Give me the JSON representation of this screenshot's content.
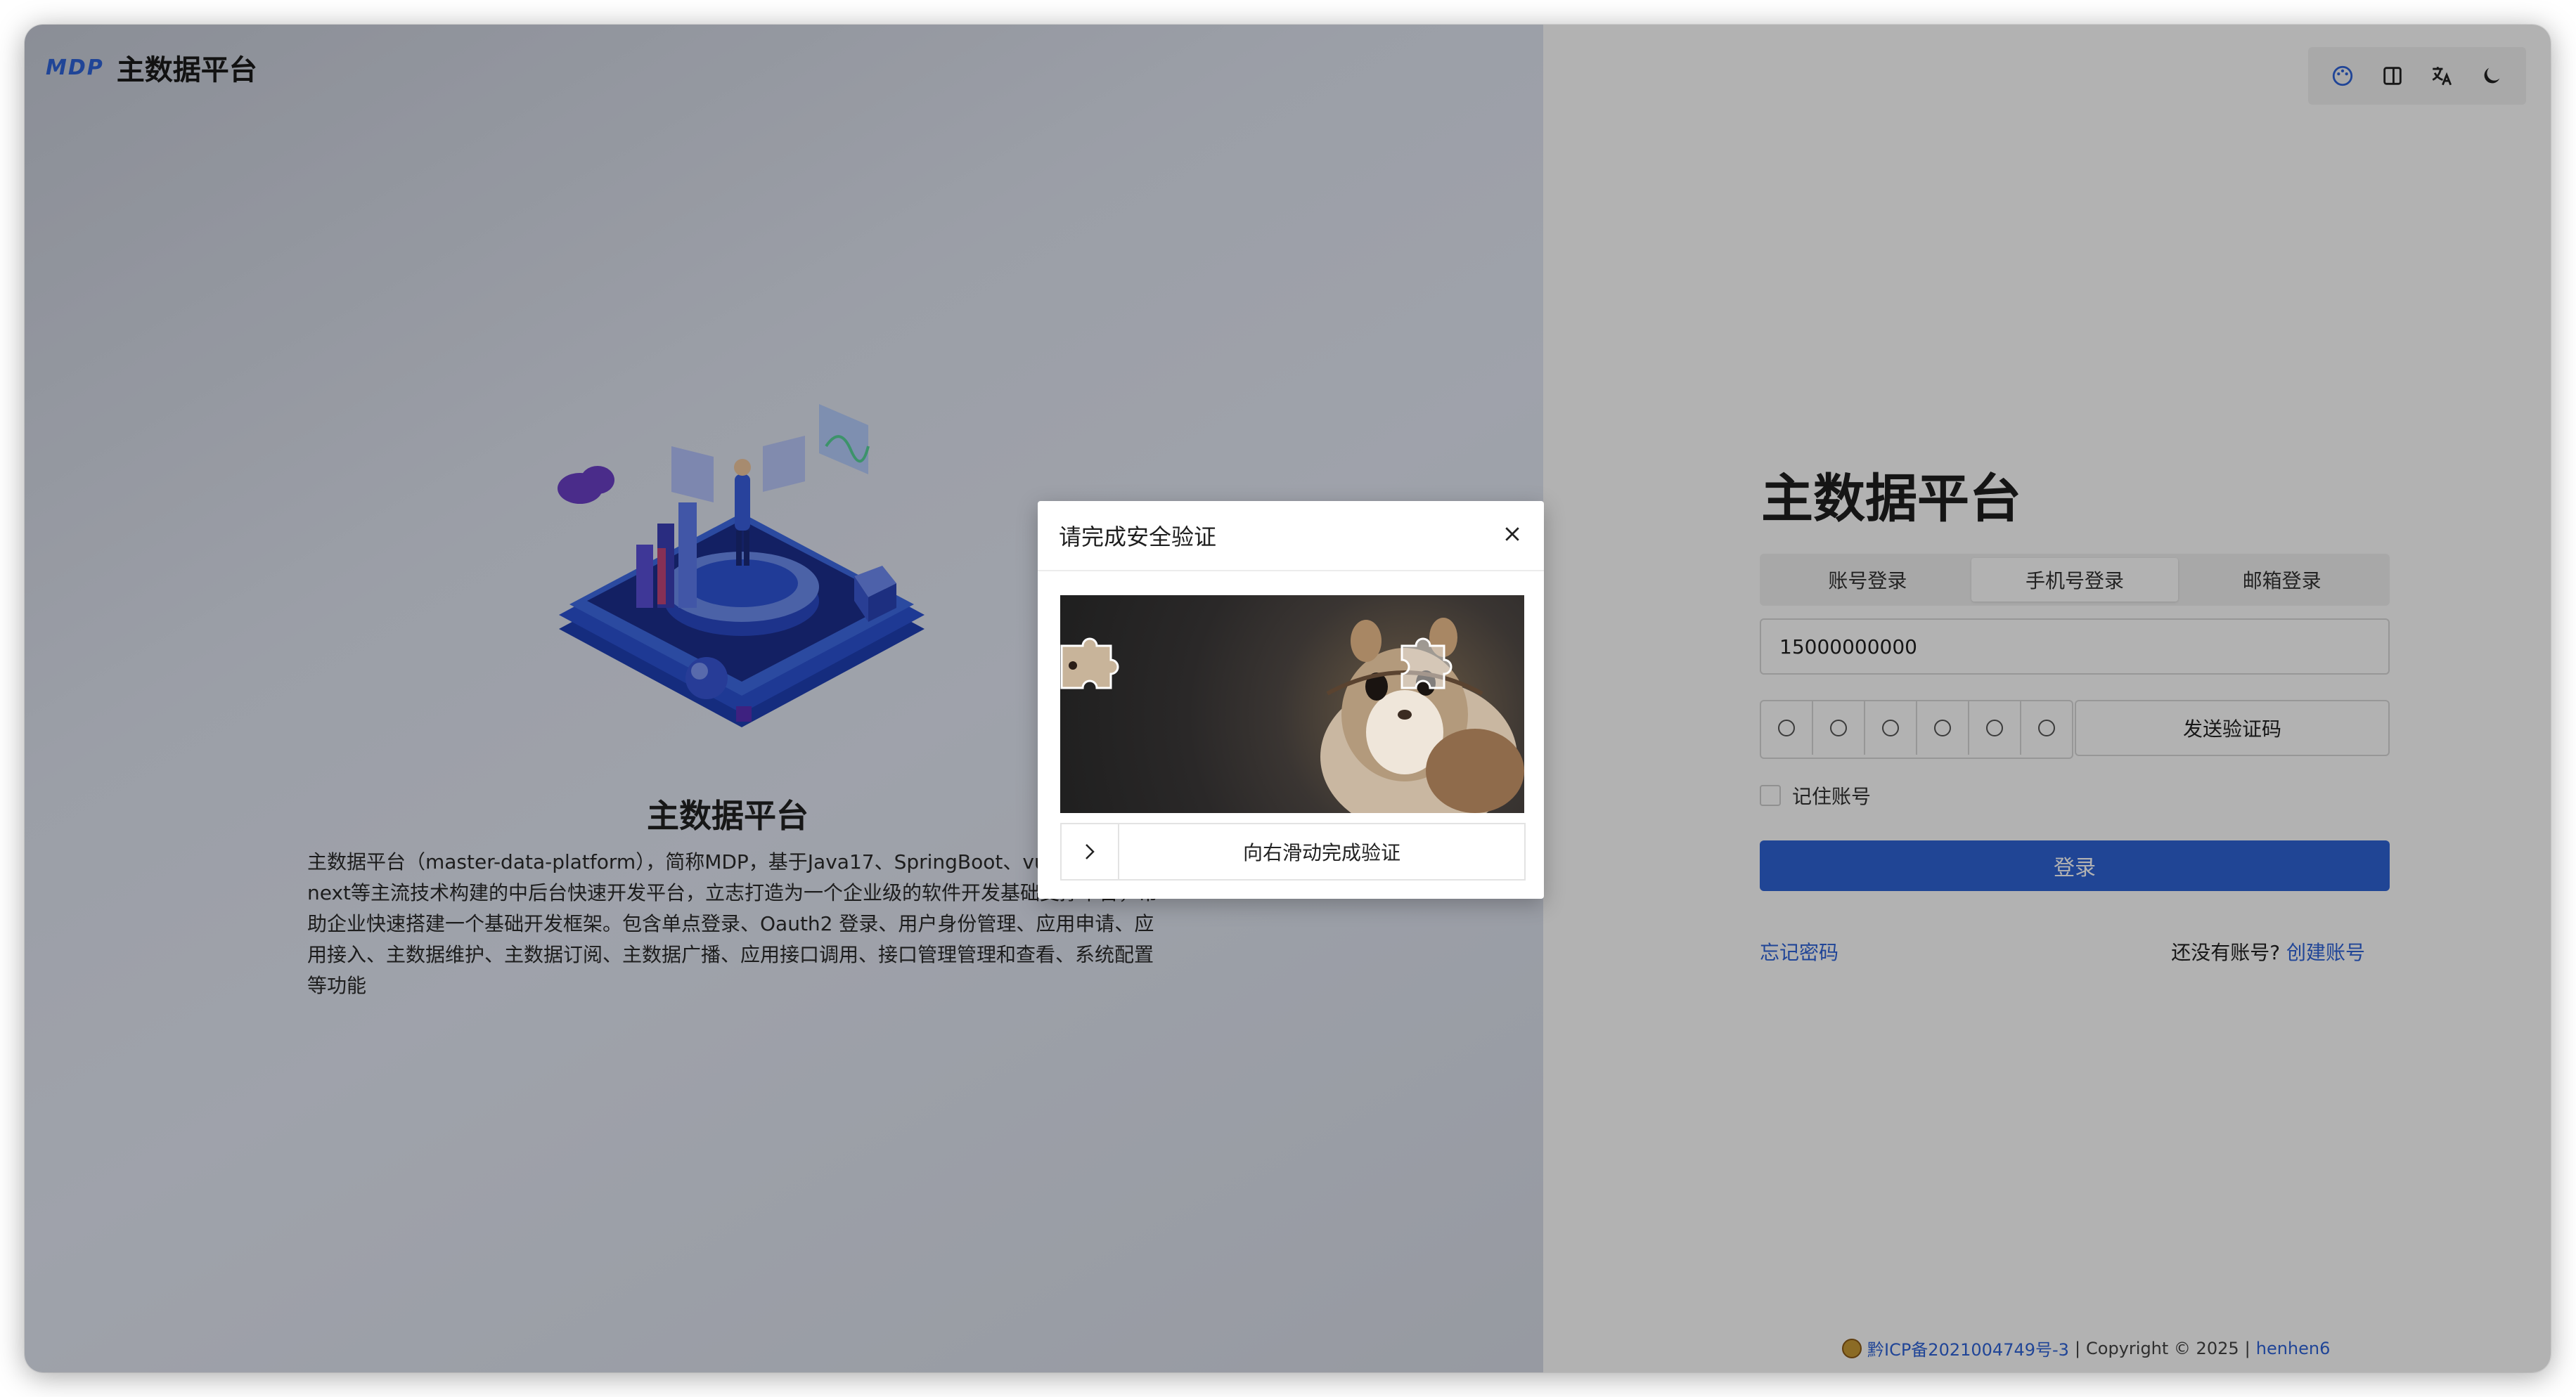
{
  "brand": {
    "logo": "MDP",
    "title": "主数据平台"
  },
  "toolbar": {
    "icons": [
      "palette-icon",
      "layout-icon",
      "translate-icon",
      "moon-icon"
    ],
    "accent": "#2f63d8"
  },
  "hero": {
    "title": "主数据平台",
    "description": "主数据平台（master-data-platform），简称MDP，基于Java17、SpringBoot、vue3、vben next等主流技术构建的中后台快速开发平台，立志打造为一个企业级的软件开发基础支撑平台，帮助企业快速搭建一个基础开发框架。包含单点登录、Oauth2 登录、用户身份管理、应用申请、应用接入、主数据维护、主数据订阅、主数据广播、应用接口调用、接口管理管理和查看、系统配置等功能"
  },
  "login": {
    "title": "主数据平台",
    "tabs": [
      {
        "label": "账号登录",
        "active": false
      },
      {
        "label": "手机号登录",
        "active": true
      },
      {
        "label": "邮箱登录",
        "active": false
      }
    ],
    "phone_value": "15000000000",
    "otp_cells": 6,
    "send_code_label": "发送验证码",
    "remember_label": "记住账号",
    "login_label": "登录",
    "forgot_label": "忘记密码",
    "no_account_text": "还没有账号?",
    "create_account_label": "创建账号",
    "primary_color": "#2e63d6"
  },
  "footer": {
    "icp": "黔ICP备2021004749号-3",
    "separator": "|",
    "copyright": "Copyright © 2025",
    "author": "henhen6"
  },
  "captcha": {
    "title": "请完成安全验证",
    "slider_text": "向右滑动完成验证"
  }
}
